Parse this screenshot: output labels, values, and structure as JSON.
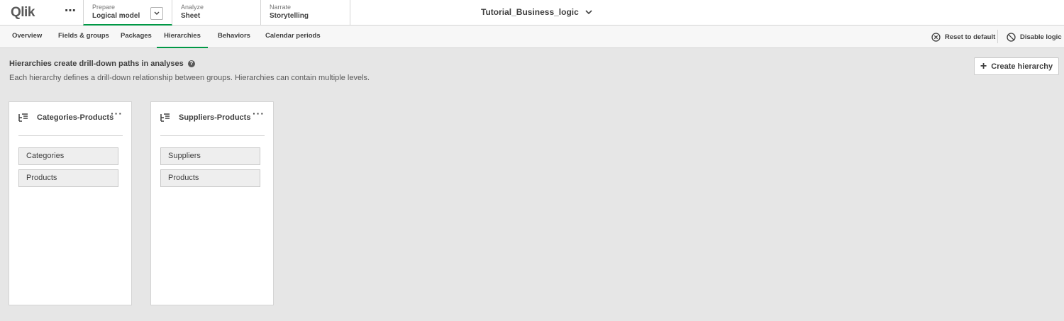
{
  "brand": {
    "logo_text": "Qlik",
    "accent_color": "#009845"
  },
  "top_nav": {
    "tabs": [
      {
        "small": "Prepare",
        "big": "Logical model",
        "active": true
      },
      {
        "small": "Analyze",
        "big": "Sheet",
        "active": false
      },
      {
        "small": "Narrate",
        "big": "Storytelling",
        "active": false
      }
    ],
    "app_title": "Tutorial_Business_logic"
  },
  "sub_nav": {
    "tabs": [
      "Overview",
      "Fields & groups",
      "Packages",
      "Hierarchies",
      "Behaviors",
      "Calendar periods"
    ],
    "active": "Hierarchies",
    "reset_label": "Reset to default",
    "disable_label": "Disable logic"
  },
  "page": {
    "heading": "Hierarchies create drill-down paths in analyses",
    "help_glyph": "?",
    "description": "Each hierarchy defines a drill-down relationship between groups. Hierarchies can contain multiple levels.",
    "create_label": "Create hierarchy"
  },
  "hierarchies": [
    {
      "name": "Categories-Products",
      "levels": [
        "Categories",
        "Products"
      ]
    },
    {
      "name": "Suppliers-Products",
      "levels": [
        "Suppliers",
        "Products"
      ]
    }
  ],
  "icons": {
    "more": "more-horizontal-icon",
    "hierarchy": "hierarchy-icon",
    "reset": "reset-circle-x-icon",
    "disable": "disable-circle-slash-icon",
    "add": "plus-icon",
    "help": "help-icon",
    "chevron": "chevron-down-icon"
  }
}
